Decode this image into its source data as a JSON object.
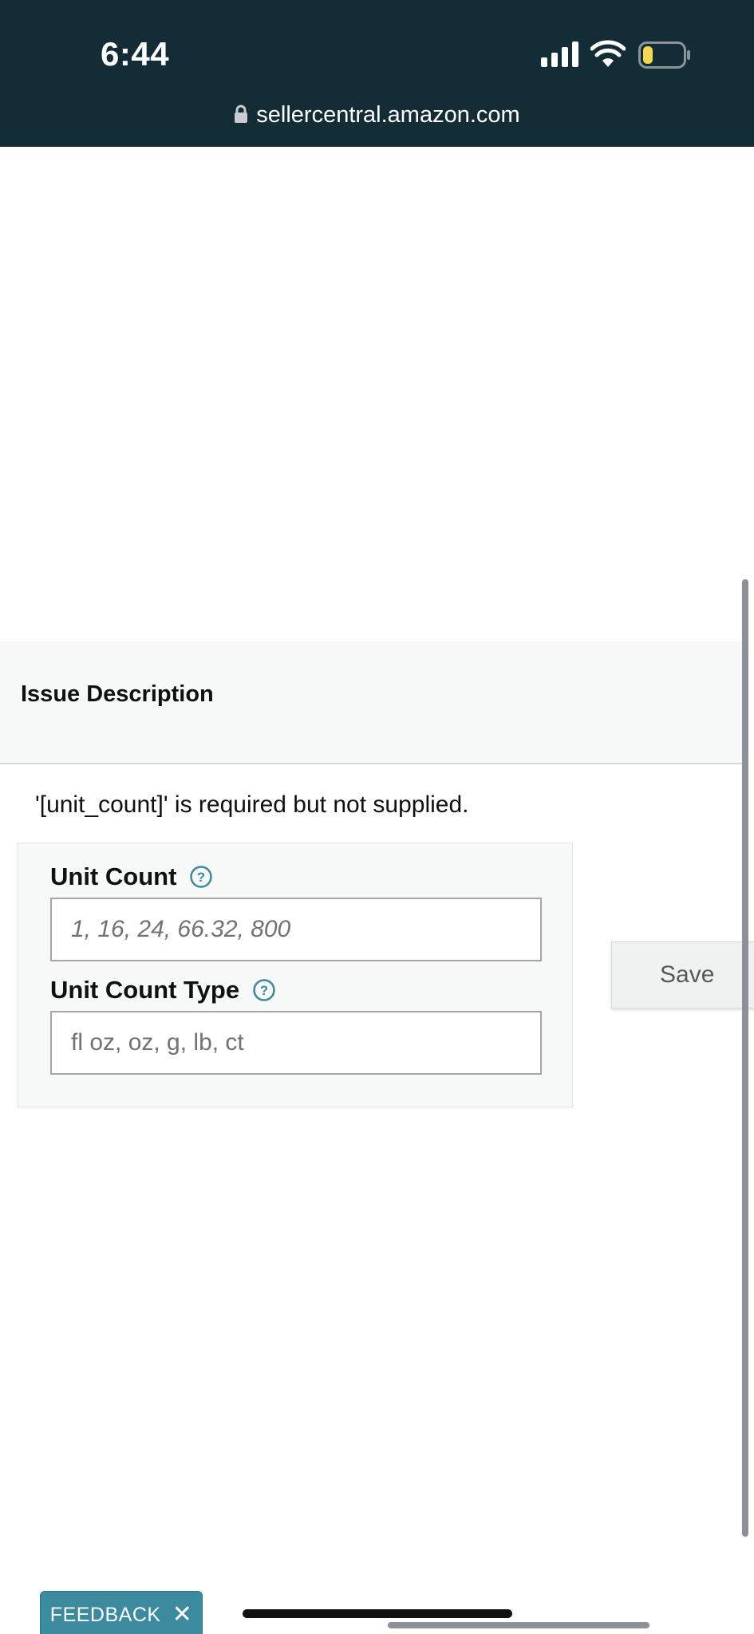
{
  "status_bar": {
    "time": "6:44",
    "signal_icon": "cellular-signal-icon",
    "wifi_icon": "wifi-icon",
    "battery_icon": "battery-low-icon",
    "battery_level": 0.2
  },
  "browser": {
    "url": "sellercentral.amazon.com",
    "lock_icon": "lock-icon"
  },
  "issue": {
    "title": "Issue Description",
    "message": "'[unit_count]' is required but not supplied."
  },
  "form": {
    "unit_count": {
      "label": "Unit Count",
      "placeholder": "1, 16, 24, 66.32, 800",
      "help_icon": "question-circle-icon"
    },
    "unit_count_type": {
      "label": "Unit Count Type",
      "placeholder": "fl oz, oz, g, lb, ct",
      "help_icon": "question-circle-icon"
    },
    "save_label": "Save"
  },
  "feedback": {
    "label": "FEEDBACK",
    "close": "✕"
  },
  "colors": {
    "header_bg": "#132c35",
    "accent": "#3c8a9e",
    "help_icon": "#3c8a9e"
  }
}
